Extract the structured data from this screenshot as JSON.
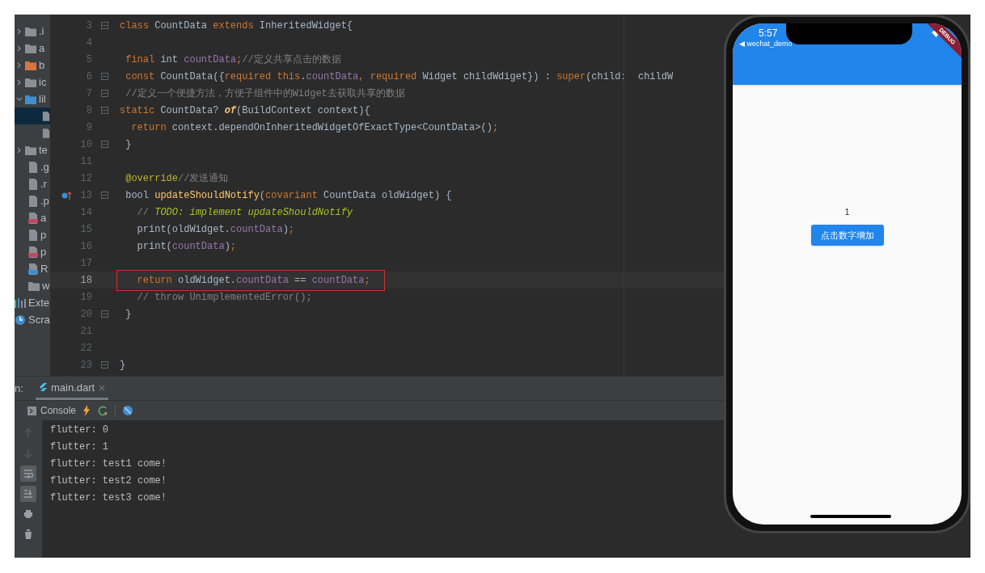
{
  "project_tree": [
    {
      "label": ".i",
      "kind": "folder-gear",
      "expanded": false,
      "selected": false
    },
    {
      "label": "a",
      "kind": "folder",
      "expanded": false,
      "selected": false
    },
    {
      "label": "b",
      "kind": "folder-orange",
      "expanded": false,
      "selected": false
    },
    {
      "label": "ic",
      "kind": "folder",
      "expanded": false,
      "selected": false
    },
    {
      "label": "lil",
      "kind": "folder-blue",
      "expanded": true,
      "selected": false
    },
    {
      "kind": "dart",
      "selected": true
    },
    {
      "kind": "dart",
      "selected": false
    },
    {
      "label": "te",
      "kind": "folder-test",
      "expanded": false,
      "selected": false
    },
    {
      "label": ".g",
      "kind": "file",
      "selected": false
    },
    {
      "label": ".r",
      "kind": "file",
      "selected": false
    },
    {
      "label": ".p",
      "kind": "file",
      "selected": false
    },
    {
      "label": "a",
      "kind": "yaml",
      "selected": false
    },
    {
      "label": "p",
      "kind": "file",
      "selected": false
    },
    {
      "label": "p",
      "kind": "yaml",
      "selected": false
    },
    {
      "label": "R",
      "kind": "md",
      "selected": false
    },
    {
      "label": "w",
      "kind": "folder-web",
      "selected": false
    },
    {
      "label": "Exte",
      "kind": "libraries",
      "selected": false
    },
    {
      "label": "Scra",
      "kind": "scratches",
      "selected": false
    }
  ],
  "editor": {
    "lines": [
      {
        "number": "3",
        "fold": true,
        "tokens": [
          {
            "text": "class ",
            "kind": "kw"
          },
          {
            "text": "CountData ",
            "kind": "id"
          },
          {
            "text": "extends ",
            "kind": "kw"
          },
          {
            "text": "InheritedWidget{",
            "kind": "id"
          }
        ]
      },
      {
        "number": "4",
        "fold": false
      },
      {
        "number": "5",
        "fold": false,
        "tokens": [
          {
            "text": " final ",
            "kind": "kw"
          },
          {
            "text": "int ",
            "kind": "id"
          },
          {
            "text": "countData",
            "kind": "field"
          },
          {
            "text": ";",
            "kind": "kw"
          },
          {
            "text": "//定义共享点击的数据",
            "kind": "comment"
          }
        ]
      },
      {
        "number": "6",
        "fold": true,
        "tokens": [
          {
            "text": " const ",
            "kind": "kw"
          },
          {
            "text": "CountData({",
            "kind": "id"
          },
          {
            "text": "required this",
            "kind": "kw"
          },
          {
            "text": ".",
            "kind": "id"
          },
          {
            "text": "countData",
            "kind": "field"
          },
          {
            "text": ", required ",
            "kind": "kw"
          },
          {
            "text": "Widget childWdiget}) : ",
            "kind": "id"
          },
          {
            "text": "super",
            "kind": "kw"
          },
          {
            "text": "(child:  childW",
            "kind": "id"
          }
        ]
      },
      {
        "number": "7",
        "fold": true,
        "tokens": [
          {
            "text": " //定义一个便捷方法，方便子组件中的Widget去获取共享的数据",
            "kind": "comment"
          }
        ]
      },
      {
        "number": "8",
        "fold": true,
        "tokens": [
          {
            "text": "static ",
            "kind": "kw"
          },
          {
            "text": "CountData? ",
            "kind": "id"
          },
          {
            "text": "of",
            "kind": "fn-italic"
          },
          {
            "text": "(BuildContext context){",
            "kind": "id"
          }
        ]
      },
      {
        "number": "9",
        "fold": false,
        "tokens": [
          {
            "text": "  return ",
            "kind": "kw"
          },
          {
            "text": "context.dependOnInheritedWidgetOfExactType<CountData>()",
            "kind": "id"
          },
          {
            "text": ";",
            "kind": "kw"
          }
        ]
      },
      {
        "number": "10",
        "fold": true,
        "tokens": [
          {
            "text": " }",
            "kind": "id"
          }
        ]
      },
      {
        "number": "11",
        "fold": false
      },
      {
        "number": "12",
        "fold": false,
        "tokens": [
          {
            "text": " @override",
            "kind": "annot"
          },
          {
            "text": "//发送通知",
            "kind": "comment"
          }
        ]
      },
      {
        "number": "13",
        "fold": true,
        "override_marker": true,
        "tokens": [
          {
            "text": " bool ",
            "kind": "id"
          },
          {
            "text": "updateShouldNotify",
            "kind": "fn"
          },
          {
            "text": "(",
            "kind": "id"
          },
          {
            "text": "covariant ",
            "kind": "kw"
          },
          {
            "text": "CountData oldWidget) {",
            "kind": "id"
          }
        ]
      },
      {
        "number": "14",
        "fold": false,
        "tokens": [
          {
            "text": "   // ",
            "kind": "comment"
          },
          {
            "text": "TODO: implement updateShouldNotify",
            "kind": "todo"
          }
        ]
      },
      {
        "number": "15",
        "fold": false,
        "tokens": [
          {
            "text": "   print(oldWidget.",
            "kind": "id"
          },
          {
            "text": "countData",
            "kind": "field"
          },
          {
            "text": ")",
            "kind": "id"
          },
          {
            "text": ";",
            "kind": "kw"
          }
        ]
      },
      {
        "number": "16",
        "fold": false,
        "tokens": [
          {
            "text": "   print(",
            "kind": "id"
          },
          {
            "text": "countData",
            "kind": "field"
          },
          {
            "text": ")",
            "kind": "id"
          },
          {
            "text": ";",
            "kind": "kw"
          }
        ]
      },
      {
        "number": "17",
        "fold": false
      },
      {
        "number": "18",
        "fold": false,
        "current": true,
        "boxed": true,
        "tokens": [
          {
            "text": "   return ",
            "kind": "kw"
          },
          {
            "text": "oldWidget.",
            "kind": "id"
          },
          {
            "text": "countData",
            "kind": "field"
          },
          {
            "text": " == ",
            "kind": "id"
          },
          {
            "text": "countData",
            "kind": "field"
          },
          {
            "text": ";",
            "kind": "kw"
          }
        ]
      },
      {
        "number": "19",
        "fold": false,
        "tokens": [
          {
            "text": "   // throw UnimplementedError();",
            "kind": "comment"
          }
        ]
      },
      {
        "number": "20",
        "fold": true,
        "tokens": [
          {
            "text": " }",
            "kind": "id"
          }
        ]
      },
      {
        "number": "21",
        "fold": false
      },
      {
        "number": "22",
        "fold": false
      },
      {
        "number": "23",
        "fold": true,
        "tokens": [
          {
            "text": "}",
            "kind": "id"
          }
        ]
      }
    ]
  },
  "run_panel": {
    "label": "n:",
    "tabs": [
      {
        "label": "main.dart",
        "selected": true,
        "closable": true
      }
    ],
    "console_tab": "Console",
    "side_tools": [
      {
        "kind": "up",
        "on": false
      },
      {
        "kind": "down",
        "on": false
      },
      {
        "kind": "wrap",
        "on": true
      },
      {
        "kind": "scroll-end",
        "on": true
      },
      {
        "kind": "print",
        "on": false
      },
      {
        "kind": "trash",
        "on": false
      }
    ],
    "output": [
      "flutter: 0",
      "flutter: 1",
      "flutter: test1 come!",
      "flutter: test2 come!",
      "flutter: test3 come!"
    ]
  },
  "phone": {
    "time": "5:57",
    "back_app": "◀ wechat_demo",
    "banner": "DEBUG",
    "counter": "1",
    "button": "点击数字增加"
  }
}
